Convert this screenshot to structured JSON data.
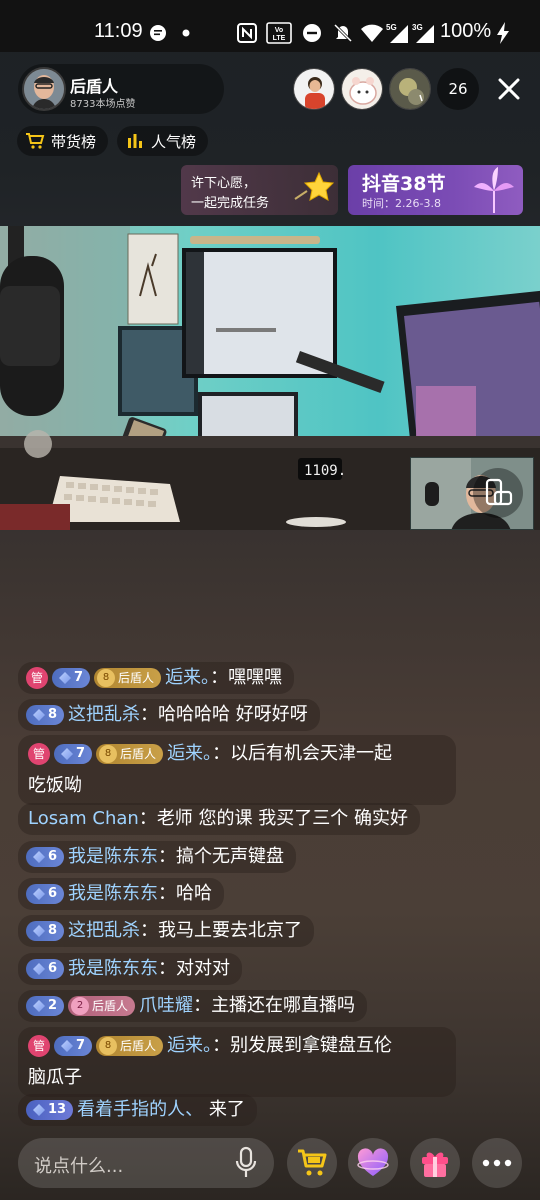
{
  "status_bar": {
    "time": "11:09",
    "battery": "100%",
    "lte_label": "VoLTE",
    "sig1": "5G",
    "sig2": "3G"
  },
  "header": {
    "host_name": "后盾人",
    "host_likes": "8733本场点赞",
    "viewer_count": "26",
    "tags": [
      "带货榜",
      "人气榜"
    ]
  },
  "banners": {
    "wish_line1": "许下心愿，",
    "wish_line2": "一起完成任务",
    "event_title": "抖音38节",
    "event_time": "时间：2.26-3.8"
  },
  "comments": [
    {
      "admin": "管",
      "level": "7",
      "fan_level": "8",
      "fan_name": "后盾人",
      "user": "逅来。",
      "text": "嘿嘿嘿"
    },
    {
      "level": "8",
      "user": "这把乱杀",
      "text": "哈哈哈哈 好呀好呀"
    },
    {
      "admin": "管",
      "level": "7",
      "fan_level": "8",
      "fan_name": "后盾人",
      "user": "逅来。",
      "text": "以后有机会天津一起",
      "text2": "吃饭呦"
    },
    {
      "user": "Losam Chan",
      "text": "老师 您的课 我买了三个 确实好"
    },
    {
      "level": "6",
      "user": "我是陈东东",
      "text": "搞个无声键盘"
    },
    {
      "level": "6",
      "user": "我是陈东东",
      "text": "哈哈"
    },
    {
      "level": "8",
      "user": "这把乱杀",
      "text": "我马上要去北京了"
    },
    {
      "level": "6",
      "user": "我是陈东东",
      "text": "对对对"
    },
    {
      "level": "2",
      "fan_level": "2",
      "fan_name": "后盾人",
      "user": "爪哇耀",
      "text": "主播还在哪直播吗"
    },
    {
      "admin": "管",
      "level": "7",
      "fan_level": "8",
      "fan_name": "后盾人",
      "user": "逅来。",
      "text": "别发展到拿键盘互伦",
      "text2": "脑瓜子"
    },
    {
      "level": "13",
      "user": "看着手指的人、",
      "text": "来了"
    }
  ],
  "video": {
    "clock_text": "1109."
  },
  "bottom_bar": {
    "input_placeholder": "说点什么..."
  },
  "colors": {
    "username": "#9fd3ff",
    "admin_badge": "#e04470",
    "level_badge": "#4e6dbf",
    "fan_badge": "#b08530",
    "event_banner": "#7b4cb5"
  }
}
